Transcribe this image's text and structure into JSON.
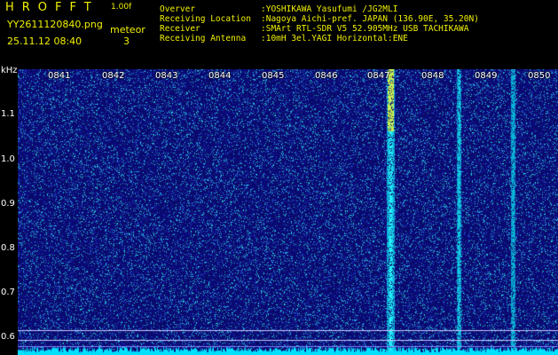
{
  "header": {
    "app_title": "HROFFT",
    "app_version": "1.00f",
    "file_name": "YY2611120840.png",
    "timestamp": "25.11.12 08:40",
    "meteor_label": "meteor",
    "meteor_count": "3"
  },
  "info": [
    {
      "key": "Overver",
      "value": ":YOSHIKAWA Yasufumi /JG2MLI"
    },
    {
      "key": "Receiving Location",
      "value": ":Nagoya Aichi-pref. JAPAN (136.90E, 35.20N)"
    },
    {
      "key": "Receiver",
      "value": ":SMArt RTL-SDR V5 52.905MHz USB TACHIKAWA"
    },
    {
      "key": "Receiving Antenna",
      "value": ":10mH 3el.YAGI Horizontal:ENE"
    }
  ],
  "axis": {
    "unit": "kHz",
    "freq_ticks": [
      "1.1",
      "1.0",
      "0.9",
      "0.8",
      "0.7",
      "0.6"
    ],
    "time_ticks": [
      "0841",
      "0842",
      "0843",
      "0844",
      "0845",
      "0846",
      "0847",
      "0848",
      "0849",
      "0850"
    ]
  },
  "colors": {
    "background": "#000000",
    "header_text": "#f0f000",
    "spectrum_base": "#0a0a6e",
    "noise_floor": "#00e0ff"
  }
}
